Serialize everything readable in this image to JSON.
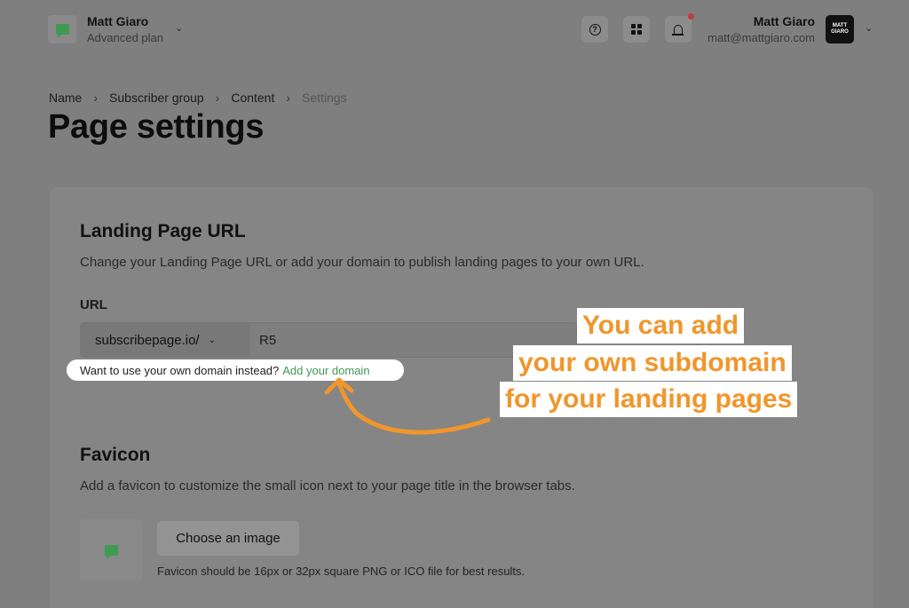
{
  "header": {
    "account_name": "Matt Giaro",
    "account_plan": "Advanced plan",
    "user_name": "Matt Giaro",
    "user_email": "matt@mattgiaro.com",
    "avatar_text": "MATT GIARO",
    "icons": [
      "chat-icon",
      "help-icon",
      "apps-grid-icon",
      "bell-icon",
      "chevron-down-icon"
    ]
  },
  "breadcrumb": {
    "items": [
      "Name",
      "Subscriber group",
      "Content"
    ],
    "current": "Settings",
    "separator": "›"
  },
  "page_title": "Page settings",
  "landing_page": {
    "title": "Landing Page URL",
    "description": "Change your Landing Page URL or add your domain to publish landing pages to your own URL.",
    "url_label": "URL",
    "url_prefix": "subscribepage.io/",
    "url_value": "R5",
    "hint_text": "Want to use your own domain instead?",
    "hint_link": "Add your domain"
  },
  "favicon": {
    "title": "Favicon",
    "description": "Add a favicon to customize the small icon next to your page title in the browser tabs.",
    "button_label": "Choose an image",
    "note": "Favicon should be 16px or 32px square PNG or ICO file for best results."
  },
  "callout": {
    "lines": [
      "You can add",
      "your own subdomain",
      "for  your landing pages"
    ],
    "color": "#f0962b"
  },
  "colors": {
    "accent_green": "#3d9a55",
    "notification": "#c03a3a"
  }
}
